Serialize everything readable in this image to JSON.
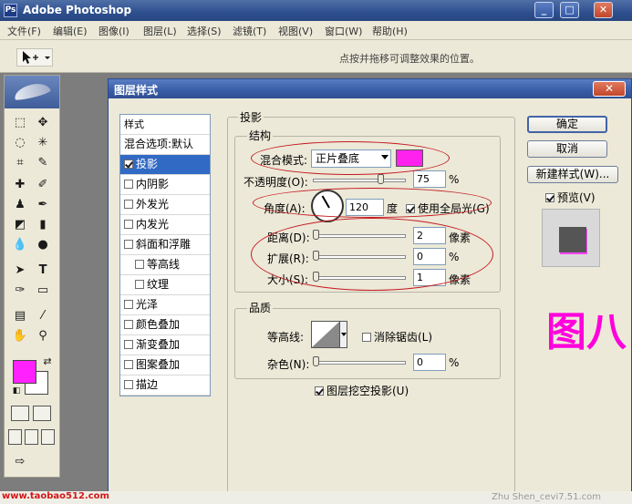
{
  "app": {
    "icon_text": "Ps",
    "title": "Adobe Photoshop",
    "win_min": "_",
    "win_max": "□",
    "win_close": "✕"
  },
  "menu": [
    "文件(F)",
    "编辑(E)",
    "图像(I)",
    "图层(L)",
    "选择(S)",
    "滤镜(T)",
    "视图(V)",
    "窗口(W)",
    "帮助(H)"
  ],
  "options_bar": {
    "tool_icon": "move-tool-icon",
    "hint": "点按并拖移可调整效果的位置。"
  },
  "toolbox": {
    "foreground_color": "#ff22ff",
    "background_color": "#ffffff"
  },
  "dialog": {
    "title": "图层样式",
    "close": "✕",
    "styles_list": {
      "header": "样式",
      "blend_options": "混合选项:默认",
      "items": [
        {
          "label": "投影",
          "checked": true,
          "selected": true
        },
        {
          "label": "内阴影",
          "checked": false
        },
        {
          "label": "外发光",
          "checked": false
        },
        {
          "label": "内发光",
          "checked": false
        },
        {
          "label": "斜面和浮雕",
          "checked": false
        },
        {
          "label": "等高线",
          "checked": false,
          "indent": true
        },
        {
          "label": "纹理",
          "checked": false,
          "indent": true
        },
        {
          "label": "光泽",
          "checked": false
        },
        {
          "label": "颜色叠加",
          "checked": false
        },
        {
          "label": "渐变叠加",
          "checked": false
        },
        {
          "label": "图案叠加",
          "checked": false
        },
        {
          "label": "描边",
          "checked": false
        }
      ]
    },
    "drop_shadow": {
      "section_title": "投影",
      "structure": {
        "title": "结构",
        "blend_mode_label": "混合模式:",
        "blend_mode_value": "正片叠底",
        "shadow_color": "#ff22ee",
        "opacity_label": "不透明度(O):",
        "opacity_value": "75",
        "opacity_unit": "%",
        "opacity_fraction": 0.75,
        "angle_label": "角度(A):",
        "angle_value": "120",
        "angle_unit": "度",
        "global_light_label": "使用全局光(G)",
        "global_light_checked": true,
        "distance_label": "距离(D):",
        "distance_value": "2",
        "distance_unit": "像素",
        "spread_label": "扩展(R):",
        "spread_value": "0",
        "spread_unit": "%",
        "size_label": "大小(S):",
        "size_value": "1",
        "size_unit": "像素"
      },
      "quality": {
        "title": "品质",
        "contour_label": "等高线:",
        "anti_alias_label": "消除锯齿(L)",
        "anti_alias_checked": false,
        "noise_label": "杂色(N):",
        "noise_value": "0",
        "noise_unit": "%"
      },
      "knockout_label": "图层挖空投影(U)",
      "knockout_checked": true
    },
    "buttons": {
      "ok": "确定",
      "cancel": "取消",
      "new_style": "新建样式(W)...",
      "preview_label": "预览(V)",
      "preview_checked": true
    }
  },
  "figure_label": "图八",
  "watermarks": {
    "left": "www.taobao512.com",
    "right": "Zhu Shen_cevi7.51.com"
  },
  "colors": {
    "annotation": "#c51a20",
    "accent_magenta": "#ff00dd"
  }
}
